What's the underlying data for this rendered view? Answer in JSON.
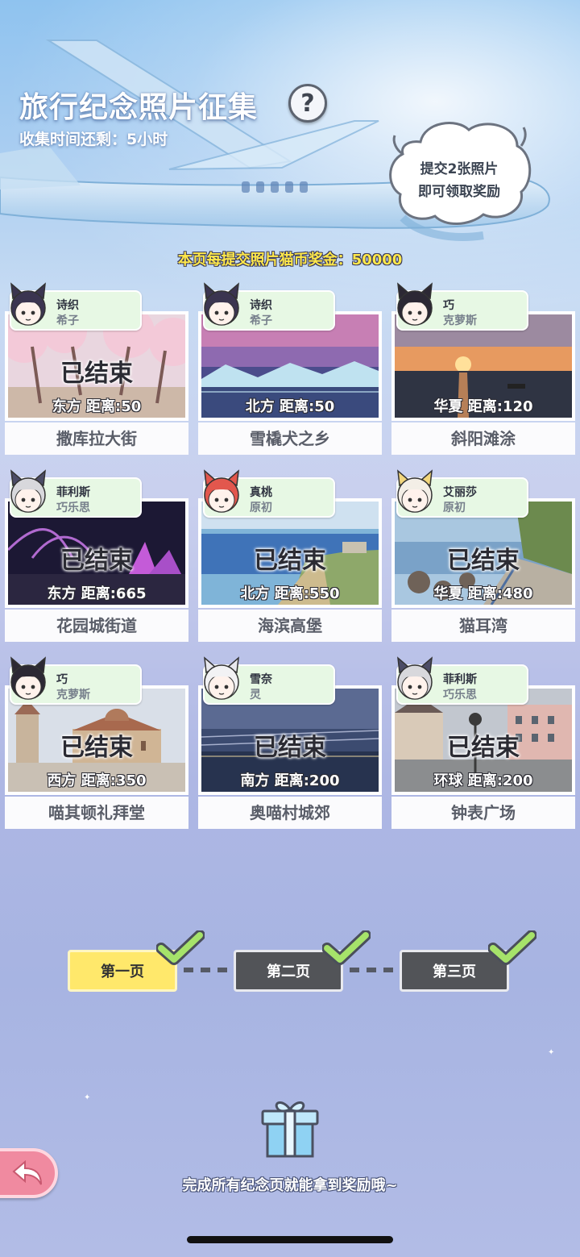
{
  "header": {
    "title": "旅行纪念照片征集",
    "help_symbol": "?",
    "countdown": "收集时间还剩：5小时",
    "bubble_line1": "提交2张照片",
    "bubble_line2": "即可领取奖励",
    "bonus": "本页每提交照片猫币奖金：50000"
  },
  "cards": [
    {
      "name": "撒库拉大街",
      "ended": "已结束",
      "distance": "东方  距离:50",
      "char1": "诗织",
      "char2": "希子",
      "scene": "cherry"
    },
    {
      "name": "雪橇犬之乡",
      "ended": "",
      "distance": "北方  距离:50",
      "char1": "诗织",
      "char2": "希子",
      "scene": "glacier"
    },
    {
      "name": "斜阳滩涂",
      "ended": "",
      "distance": "华夏  距离:120",
      "char1": "巧",
      "char2": "克萝斯",
      "scene": "sunset"
    },
    {
      "name": "花园城街道",
      "ended": "已结束",
      "distance": "东方  距离:665",
      "char1": "菲利斯",
      "char2": "巧乐思",
      "scene": "night"
    },
    {
      "name": "海滨高堡",
      "ended": "已结束",
      "distance": "北方  距离:550",
      "char1": "真桃",
      "char2": "原初",
      "scene": "coast"
    },
    {
      "name": "猫耳湾",
      "ended": "已结束",
      "distance": "华夏  距离:480",
      "char1": "艾丽莎",
      "char2": "原初",
      "scene": "bay"
    },
    {
      "name": "喵其顿礼拜堂",
      "ended": "已结束",
      "distance": "西方  距离:350",
      "char1": "巧",
      "char2": "克萝斯",
      "scene": "church"
    },
    {
      "name": "奥喵村城郊",
      "ended": "已结束",
      "distance": "南方  距离:200",
      "char1": "雪奈",
      "char2": "灵",
      "scene": "dusk"
    },
    {
      "name": "钟表广场",
      "ended": "已结束",
      "distance": "环球  距离:200",
      "char1": "菲利斯",
      "char2": "巧乐思",
      "scene": "plaza"
    }
  ],
  "pager": {
    "pages": [
      {
        "label": "第一页",
        "active": true,
        "done": true
      },
      {
        "label": "第二页",
        "active": false,
        "done": true
      },
      {
        "label": "第三页",
        "active": false,
        "done": true
      }
    ]
  },
  "footer": {
    "reward_text": "完成所有纪念页就能拿到奖励哦~"
  },
  "colors": {
    "tag_bg": "#e7f8e4",
    "active_page": "#ffe86b",
    "inactive_page": "#525458",
    "check_green": "#a6e36a",
    "back_button": "#f08aa0",
    "bonus_text": "#ffe84a"
  }
}
